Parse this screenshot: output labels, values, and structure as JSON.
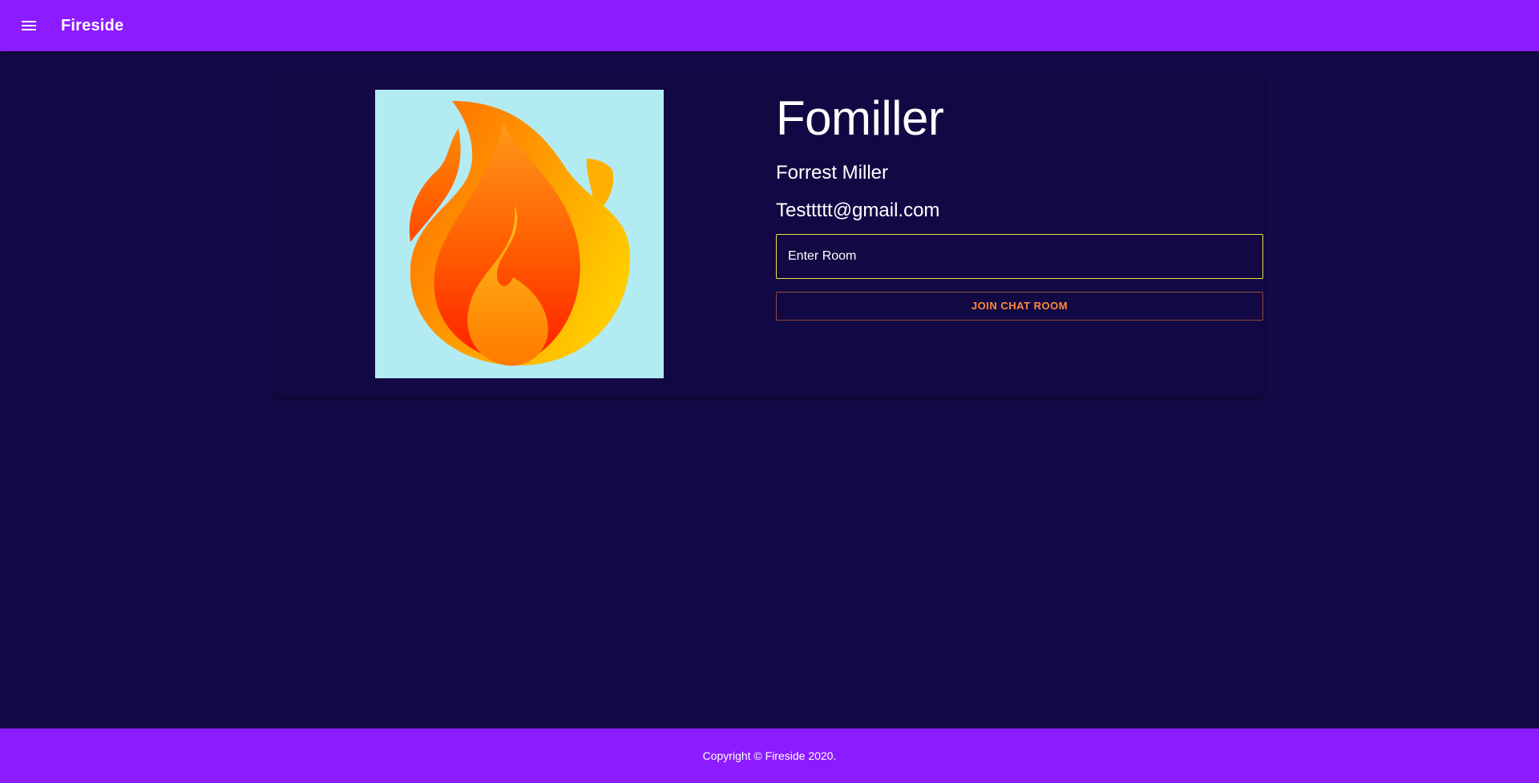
{
  "appbar": {
    "title": "Fireside"
  },
  "profile": {
    "username": "Fomiller",
    "full_name": "Forrest Miller",
    "email": "Testtttt@gmail.com",
    "room_input": {
      "placeholder": "Enter Room",
      "value": ""
    },
    "join_button_label": "Join Chat Room"
  },
  "footer": {
    "copyright": "Copyright © Fireside 2020."
  },
  "colors": {
    "appbar": "#8c1cff",
    "background": "#150a47",
    "card": "#120944",
    "avatar_background": "#b3ebf2",
    "input_border": "#e9e23f",
    "button_text": "#ff8a3d"
  },
  "icons": {
    "menu": "menu-icon",
    "avatar": "fire-icon"
  }
}
